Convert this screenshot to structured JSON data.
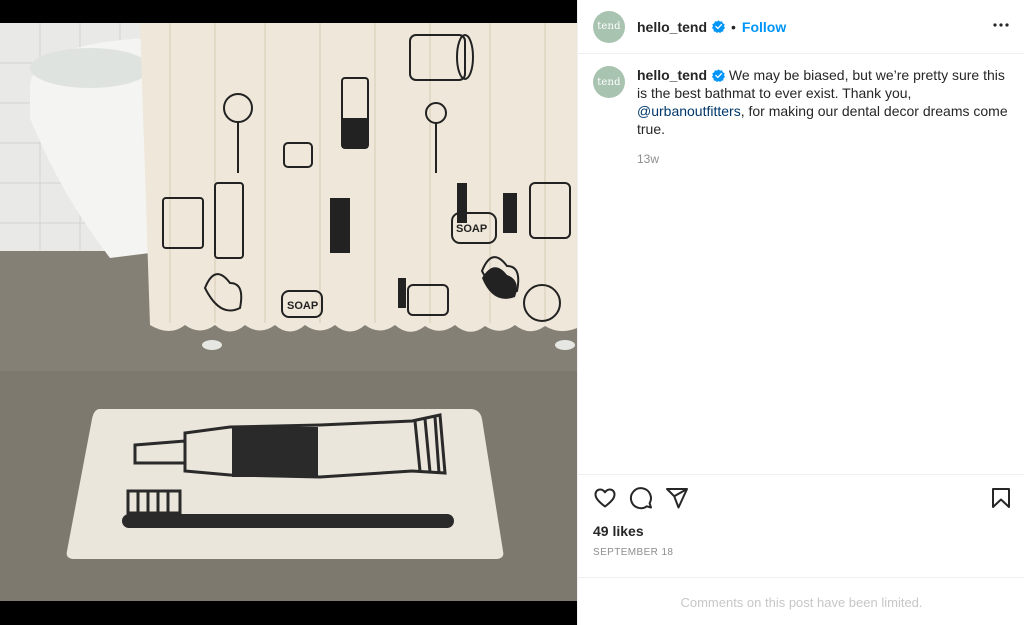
{
  "post": {
    "username": "hello_tend",
    "avatar_text": "tend",
    "dot": "•",
    "follow_label": "Follow",
    "caption_text": "We may be biased, but we’re pretty sure this is the best bathmat to ever exist. Thank you, ",
    "mention": "@urbanoutfitters",
    "caption_end": ", for making our dental decor dreams come true.",
    "age": "13w",
    "likes": "49 likes",
    "date": "SEPTEMBER 18",
    "comments_limited": "Comments on this post have been limited."
  },
  "icons": {
    "verified": "verified-badge-icon",
    "more": "more-options-icon",
    "like": "heart-icon",
    "comment": "comment-icon",
    "share": "share-icon",
    "save": "bookmark-icon"
  },
  "colors": {
    "accent": "#0095f6",
    "mention": "#00376b",
    "avatar_bg": "#a8c3b0"
  }
}
